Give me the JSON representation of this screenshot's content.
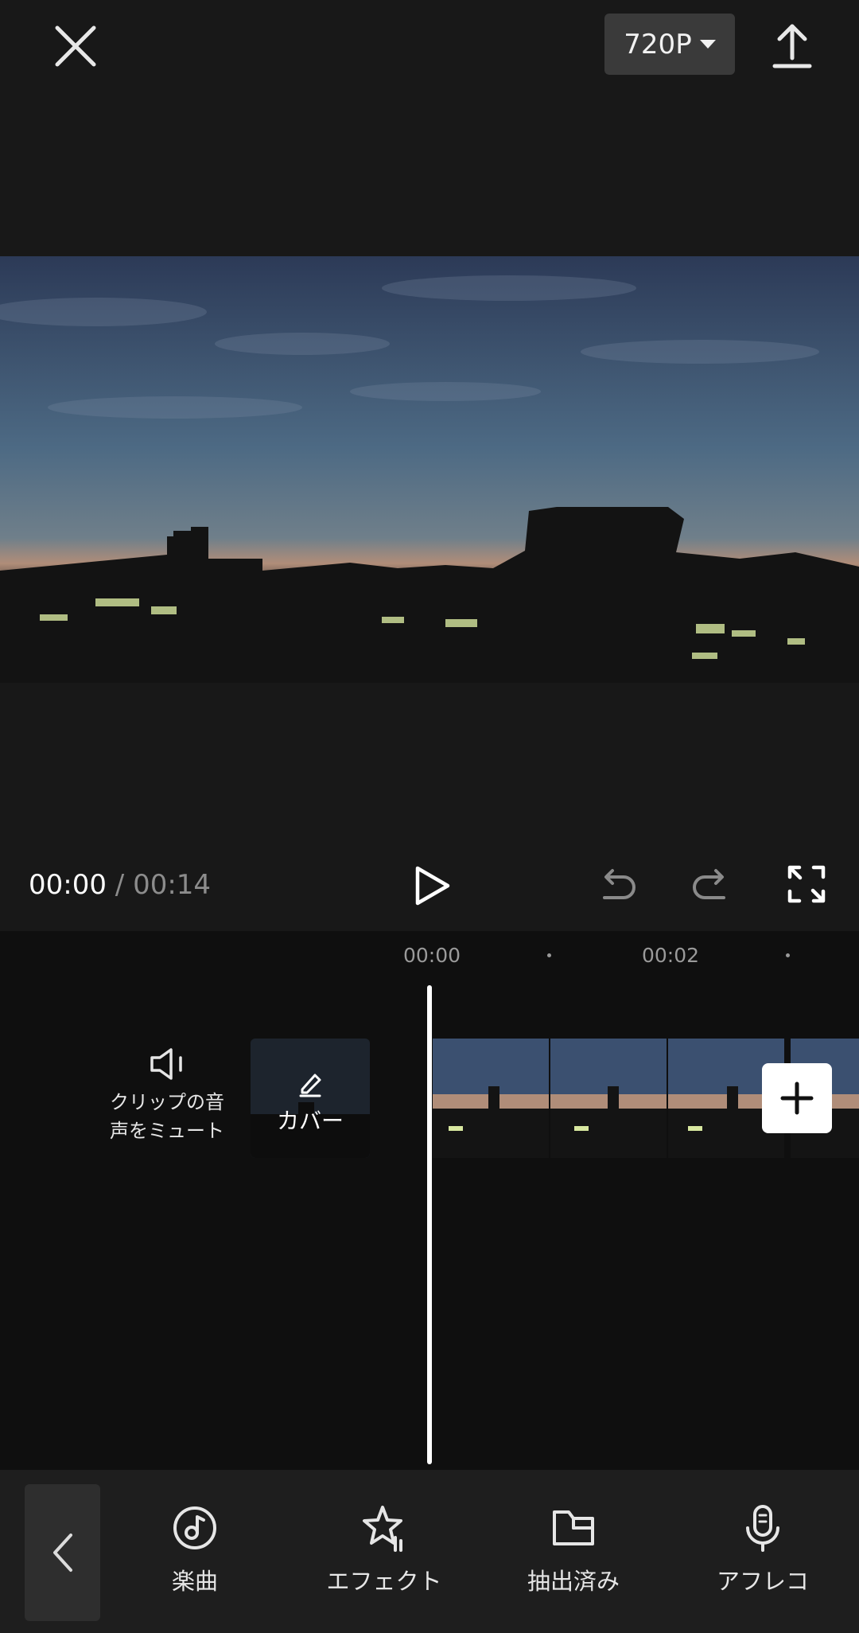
{
  "header": {
    "resolution": "720P",
    "close_icon": "close-icon",
    "export_icon": "export-upload-icon"
  },
  "player": {
    "current_time": "00:00",
    "separator": "/",
    "total_time": "00:14",
    "play_icon": "play-icon",
    "undo_icon": "undo-icon",
    "redo_icon": "redo-icon",
    "fullscreen_icon": "fullscreen-icon"
  },
  "timeline": {
    "ruler": [
      "00:00",
      "00:02"
    ],
    "mute_label": "クリップの音\n声をミュート",
    "cover_label": "カバー",
    "add_icon": "plus-icon",
    "clip_count": 4
  },
  "toolbar": {
    "back_icon": "chevron-left-icon",
    "items": [
      {
        "label": "楽曲",
        "icon": "music-note-icon"
      },
      {
        "label": "エフェクト",
        "icon": "star-effect-icon"
      },
      {
        "label": "抽出済み",
        "icon": "folder-icon"
      },
      {
        "label": "アフレコ",
        "icon": "microphone-icon"
      }
    ]
  },
  "colors": {
    "background": "#181818",
    "timeline_bg": "#0f0f0f",
    "toolbar_bg": "#1e1e1e",
    "accent": "#ffffff",
    "muted_text": "#8c8c8c"
  }
}
